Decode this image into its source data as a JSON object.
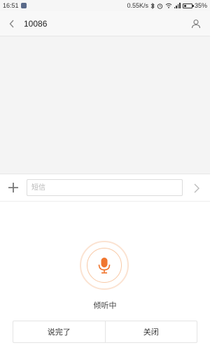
{
  "status_bar": {
    "time": "16:51",
    "network_speed": "0.55K/s",
    "battery_percent": "35%",
    "battery_level": 0.35
  },
  "header": {
    "title": "10086"
  },
  "composer": {
    "placeholder": "短信"
  },
  "voice": {
    "status": "倾听中",
    "done_label": "说完了",
    "close_label": "关闭"
  },
  "colors": {
    "accent": "#f0762f",
    "ring_outer": "#fbe3d2",
    "ring_inner": "#f8c9a6",
    "conversation_bg": "#f4f4f4"
  }
}
